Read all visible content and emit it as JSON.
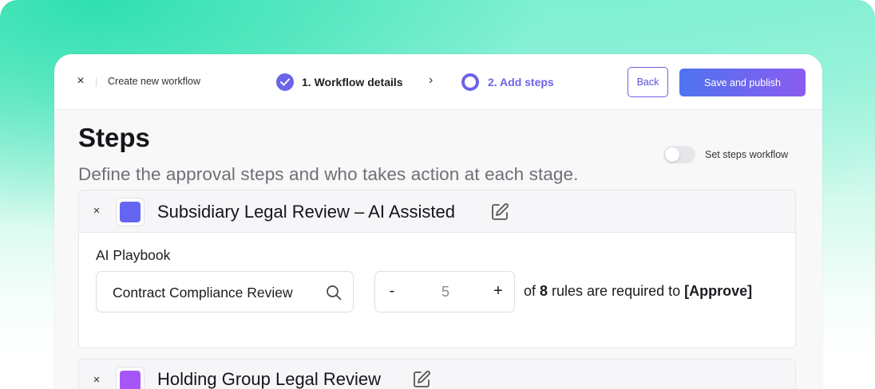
{
  "header": {
    "close_label": "×",
    "breadcrumb": "Create new workflow",
    "steps": [
      {
        "label": "1. Workflow details",
        "state": "complete"
      },
      {
        "label": "2. Add steps",
        "state": "current"
      }
    ],
    "chevron": "›",
    "back_label": "Back",
    "publish_label": "Save and publish"
  },
  "main": {
    "title": "Steps",
    "subtitle": "Define the approval steps and who takes action at each stage.",
    "toggle": {
      "label": "Set steps workflow",
      "on": false
    }
  },
  "step_cards": [
    {
      "remove_label": "×",
      "color": "#6366f1",
      "name": "Subsidiary Legal Review – AI Assisted",
      "playbook_label": "AI Playbook",
      "playbook_value": "Contract Compliance Review",
      "stepper": {
        "minus": "-",
        "value": "5",
        "plus": "+"
      },
      "rule_prefix": "of ",
      "rule_total": "8",
      "rule_middle": " rules are required to ",
      "rule_action": "[Approve]"
    },
    {
      "remove_label": "×",
      "color": "#a855f7",
      "name": "Holding Group Legal Review"
    }
  ],
  "colors": {
    "accent": "#6b63e8",
    "publish_gradient_start": "#4f73f0",
    "publish_gradient_end": "#8a5cf0"
  }
}
